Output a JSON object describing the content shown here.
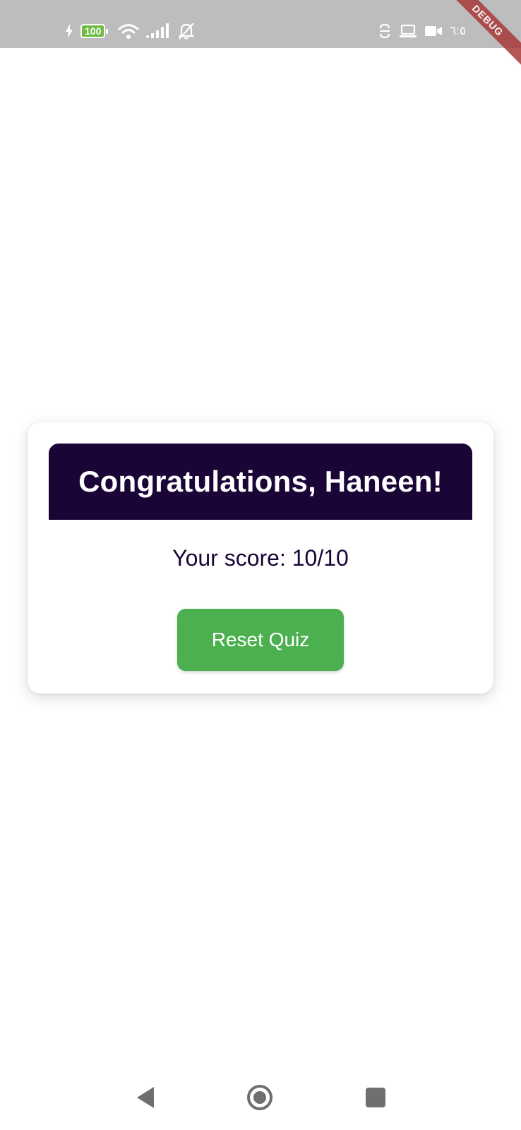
{
  "status_bar": {
    "battery_level": "100",
    "clock": "٦:٥",
    "icons": [
      "charging-icon",
      "battery-icon",
      "wifi-icon",
      "signal-icon",
      "bell-off-icon",
      "sync-icon",
      "laptop-icon",
      "video-icon"
    ]
  },
  "debug_banner": "DEBUG",
  "result": {
    "title": "Congratulations, Haneen!",
    "score": "Your score: 10/10",
    "reset_label": "Reset Quiz"
  },
  "colors": {
    "header_bg": "#1a0536",
    "button_bg": "#4caf50",
    "status_bar_bg": "#bdbdbd",
    "debug_ribbon": "#a83a3a"
  },
  "nav_bar": {
    "icons": [
      "back-icon",
      "home-icon",
      "recents-icon"
    ]
  }
}
